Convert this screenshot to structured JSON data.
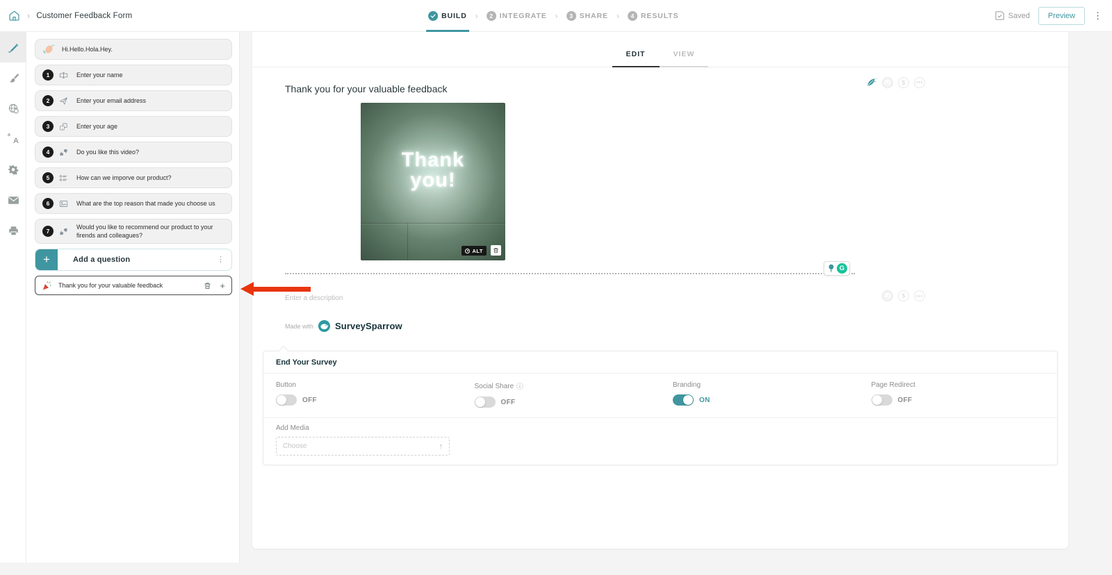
{
  "topbar": {
    "title": "Customer Feedback Form",
    "steps": [
      {
        "label": "BUILD",
        "icon": "check-circle",
        "active": true
      },
      {
        "num": "2",
        "label": "INTEGRATE"
      },
      {
        "num": "3",
        "label": "SHARE"
      },
      {
        "num": "4",
        "label": "RESULTS"
      }
    ],
    "saved_label": "Saved",
    "preview_label": "Preview"
  },
  "icon_rail": {
    "active_item": "edit-pencil",
    "items": [
      "edit-pencil",
      "theme-brush",
      "globe-language",
      "translate",
      "settings-gear",
      "email-envelope",
      "printer"
    ]
  },
  "left_panel": {
    "welcome_card": {
      "icon": "waving-hand-emoji",
      "label": "Hi.Hello.Hola.Hey."
    },
    "questions": [
      {
        "num": "1",
        "icon": "short-text",
        "label": "Enter your name"
      },
      {
        "num": "2",
        "icon": "email-paper-plane",
        "label": "Enter your email address"
      },
      {
        "num": "3",
        "icon": "number-input",
        "label": "Enter your age"
      },
      {
        "num": "4",
        "icon": "like-dislike",
        "label": "Do you like this video?"
      },
      {
        "num": "5",
        "icon": "multiple-choice",
        "label": "How can we imporve our product?"
      },
      {
        "num": "6",
        "icon": "picture-choice",
        "label": "What are the top reason that made you choose us"
      },
      {
        "num": "7",
        "icon": "thumbs-rating",
        "label": "Would you like to recommend our product to your firends and colleagues?"
      }
    ],
    "add_question_label": "Add a question",
    "thank_you_card": {
      "icon": "party-popper-emoji",
      "label": "Thank you for your valuable feedback"
    }
  },
  "canvas": {
    "tabs": [
      {
        "label": "EDIT",
        "active": true
      },
      {
        "label": "VIEW",
        "active": false
      }
    ],
    "question_title": "Thank you for your valuable feedback",
    "image": {
      "line1": "Thank",
      "line2": "you!",
      "alt_badge": "ALT"
    },
    "description_placeholder": "Enter a description",
    "made_with_label": "Made with",
    "brand_name": "SurveySparrow"
  },
  "end_survey": {
    "title": "End Your Survey",
    "toggles": [
      {
        "label": "Button",
        "state": "OFF",
        "info": false
      },
      {
        "label": "Social Share",
        "state": "OFF",
        "info": true
      },
      {
        "label": "Branding",
        "state": "ON",
        "info": false
      },
      {
        "label": "Page Redirect",
        "state": "OFF",
        "info": false
      }
    ],
    "add_media_label": "Add Media",
    "choose_placeholder": "Choose"
  },
  "colors": {
    "accent": "#3f96a0",
    "arrow_red": "#e8350e",
    "grammarly_green": "#15c39a",
    "toggle_off": "#d9d9d9",
    "step_inactive": "#b5b5b5",
    "question_badge": "#1c1c1c"
  }
}
